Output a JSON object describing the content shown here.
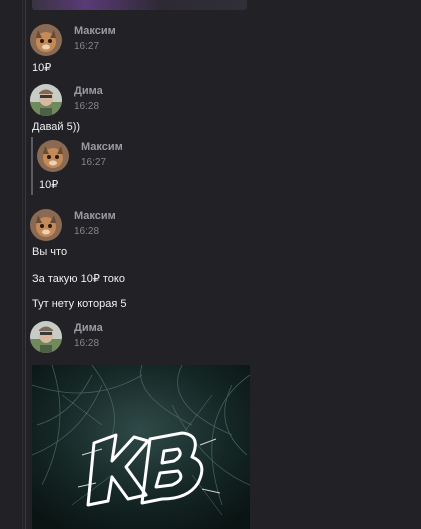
{
  "messages": [
    {
      "author": "Максим",
      "time": "16:27",
      "lines": [
        "10₽"
      ]
    },
    {
      "author": "Дима",
      "time": "16:28",
      "lines": [
        "Давай 5))"
      ],
      "quote": {
        "author": "Максим",
        "time": "16:27",
        "text": "10₽"
      }
    },
    {
      "author": "Максим",
      "time": "16:28",
      "lines": [
        "Вы что",
        "За такую 10₽ токо",
        "Тут нету которая 5"
      ]
    },
    {
      "author": "Дима",
      "time": "16:28",
      "lines": []
    }
  ],
  "attachment": {
    "logo_text": "KB"
  }
}
